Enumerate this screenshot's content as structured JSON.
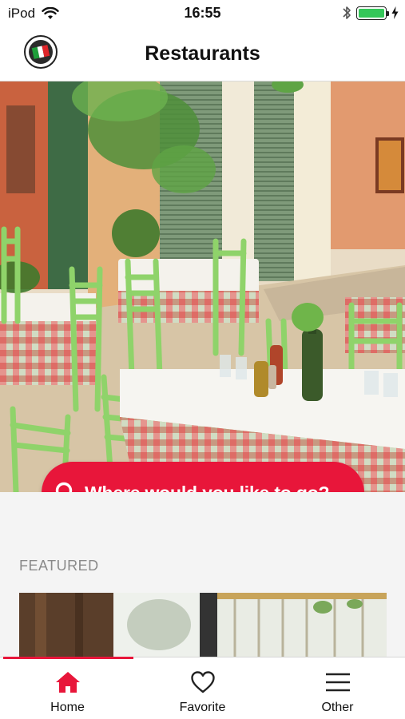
{
  "status_bar": {
    "carrier": "iPod",
    "time": "16:55",
    "battery_level": 1.0
  },
  "nav": {
    "title": "Restaurants",
    "logo_icon": "italian-flag-logo-icon"
  },
  "search": {
    "label": "Where would you like to go?",
    "icon": "search-icon"
  },
  "featured": {
    "heading": "FEATURED"
  },
  "tabs": [
    {
      "label": "Home",
      "icon": "home-icon",
      "active": true
    },
    {
      "label": "Favorite",
      "icon": "heart-icon",
      "active": false
    },
    {
      "label": "Other",
      "icon": "menu-icon",
      "active": false
    }
  ],
  "colors": {
    "accent": "#e8163a",
    "battery": "#34c759",
    "featured_heading": "#8a8a8a",
    "background": "#f4f4f4"
  }
}
